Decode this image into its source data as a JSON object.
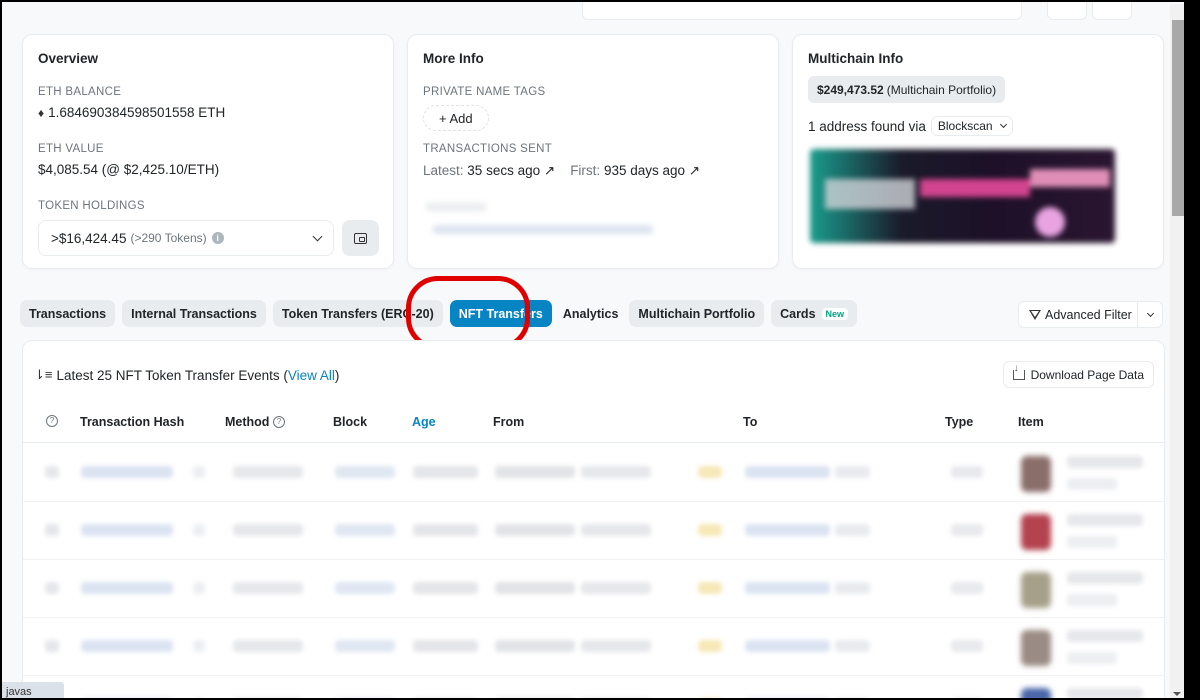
{
  "overview": {
    "title": "Overview",
    "eth_balance_label": "ETH BALANCE",
    "eth_balance_value": "1.684690384598501558 ETH",
    "eth_value_label": "ETH VALUE",
    "eth_value": "$4,085.54 (@ $2,425.10/ETH)",
    "token_holdings_label": "TOKEN HOLDINGS",
    "token_holdings_value": ">$16,424.45",
    "token_holdings_count": "(>290 Tokens)",
    "info_icon": "i"
  },
  "more_info": {
    "title": "More Info",
    "private_tags_label": "PRIVATE NAME TAGS",
    "add_button": "+ Add",
    "tx_sent_label": "TRANSACTIONS SENT",
    "latest_label": "Latest:",
    "latest_value": "35 secs ago ↗",
    "first_label": "First:",
    "first_value": "935 days ago ↗"
  },
  "multichain": {
    "title": "Multichain Info",
    "portfolio_value": "$249,473.52",
    "portfolio_label": "(Multichain Portfolio)",
    "address_found": "1 address found via",
    "source_select": "Blockscan"
  },
  "tabs": [
    {
      "label": "Transactions",
      "active": false
    },
    {
      "label": "Internal Transactions",
      "active": false
    },
    {
      "label": "Token Transfers (ERC-20)",
      "active": false
    },
    {
      "label": "NFT Transfers",
      "active": true
    },
    {
      "label": "Analytics",
      "active": false
    },
    {
      "label": "Multichain Portfolio",
      "active": false
    },
    {
      "label": "Cards",
      "active": false,
      "badge": "New"
    }
  ],
  "advanced_filter": {
    "label": "Advanced Filter"
  },
  "table": {
    "title_prefix": "Latest 25 NFT Token Transfer Events (",
    "view_all": "View All",
    "title_suffix": ")",
    "download_button": "Download Page Data",
    "columns": {
      "help": "?",
      "tx_hash": "Transaction Hash",
      "method": "Method",
      "block": "Block",
      "age": "Age",
      "from": "From",
      "to": "To",
      "type": "Type",
      "item": "Item"
    },
    "row_count_visible": 5,
    "thumb_colors": [
      "#8a6e6a",
      "#b4424f",
      "#a6a08a",
      "#9a8c84",
      "#4a66a8"
    ]
  },
  "status_bar": {
    "text": "javas"
  },
  "colors": {
    "accent": "#0784c3",
    "highlight_ring": "#e00000",
    "new_badge": "#00a186"
  }
}
